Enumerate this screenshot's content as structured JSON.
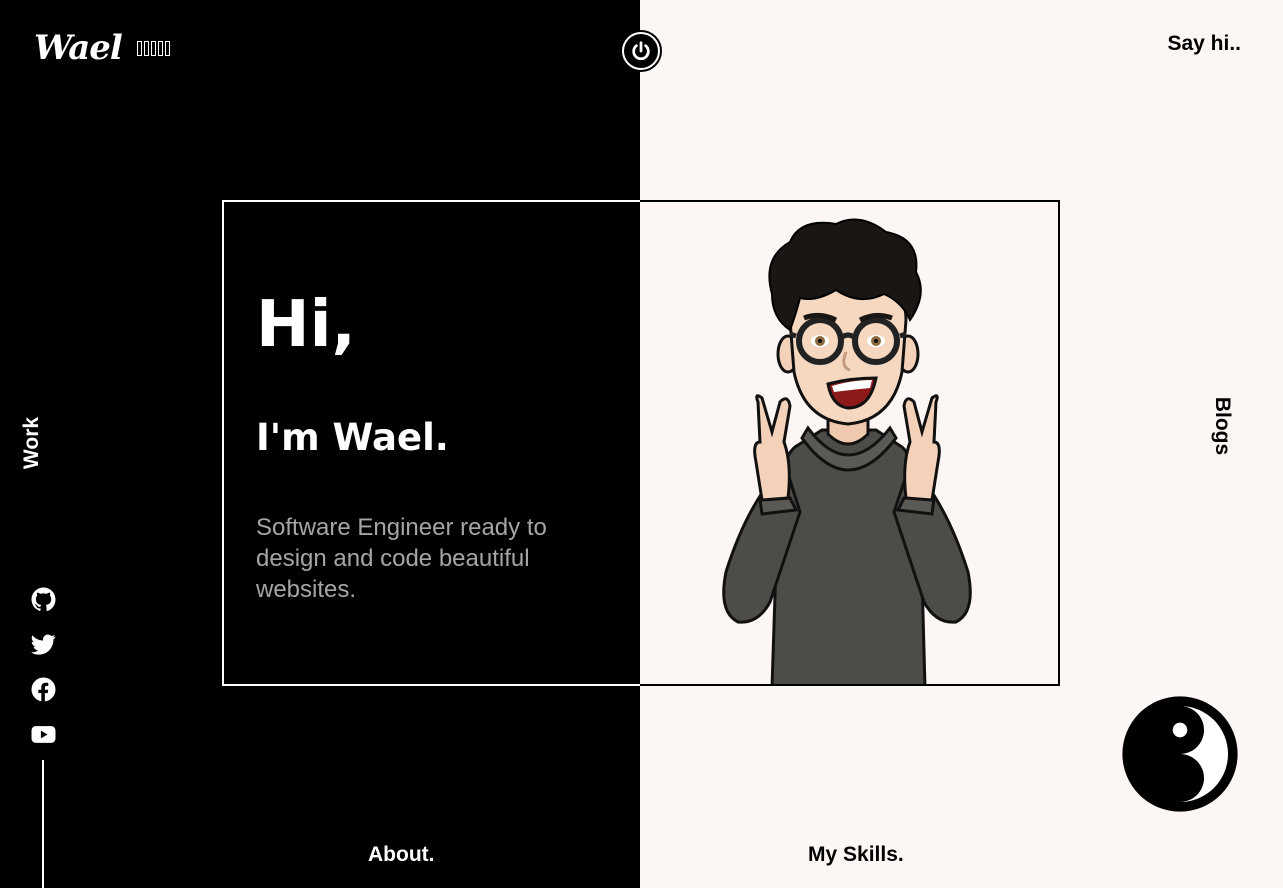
{
  "header": {
    "logo": "Wael",
    "say_hi": "Say hi.."
  },
  "nav": {
    "work": "Work",
    "blogs": "Blogs",
    "about": "About.",
    "skills": "My Skills."
  },
  "hero": {
    "greeting": "Hi,",
    "name": "I'm Wael.",
    "tagline": "Software Engineer ready to design and code beautiful websites."
  },
  "socials": [
    {
      "icon": "github-icon"
    },
    {
      "icon": "twitter-icon"
    },
    {
      "icon": "facebook-icon"
    },
    {
      "icon": "youtube-icon"
    }
  ],
  "colors": {
    "dark": "#000000",
    "light": "#fcf6f4",
    "muted_text": "#a5a5a5"
  }
}
